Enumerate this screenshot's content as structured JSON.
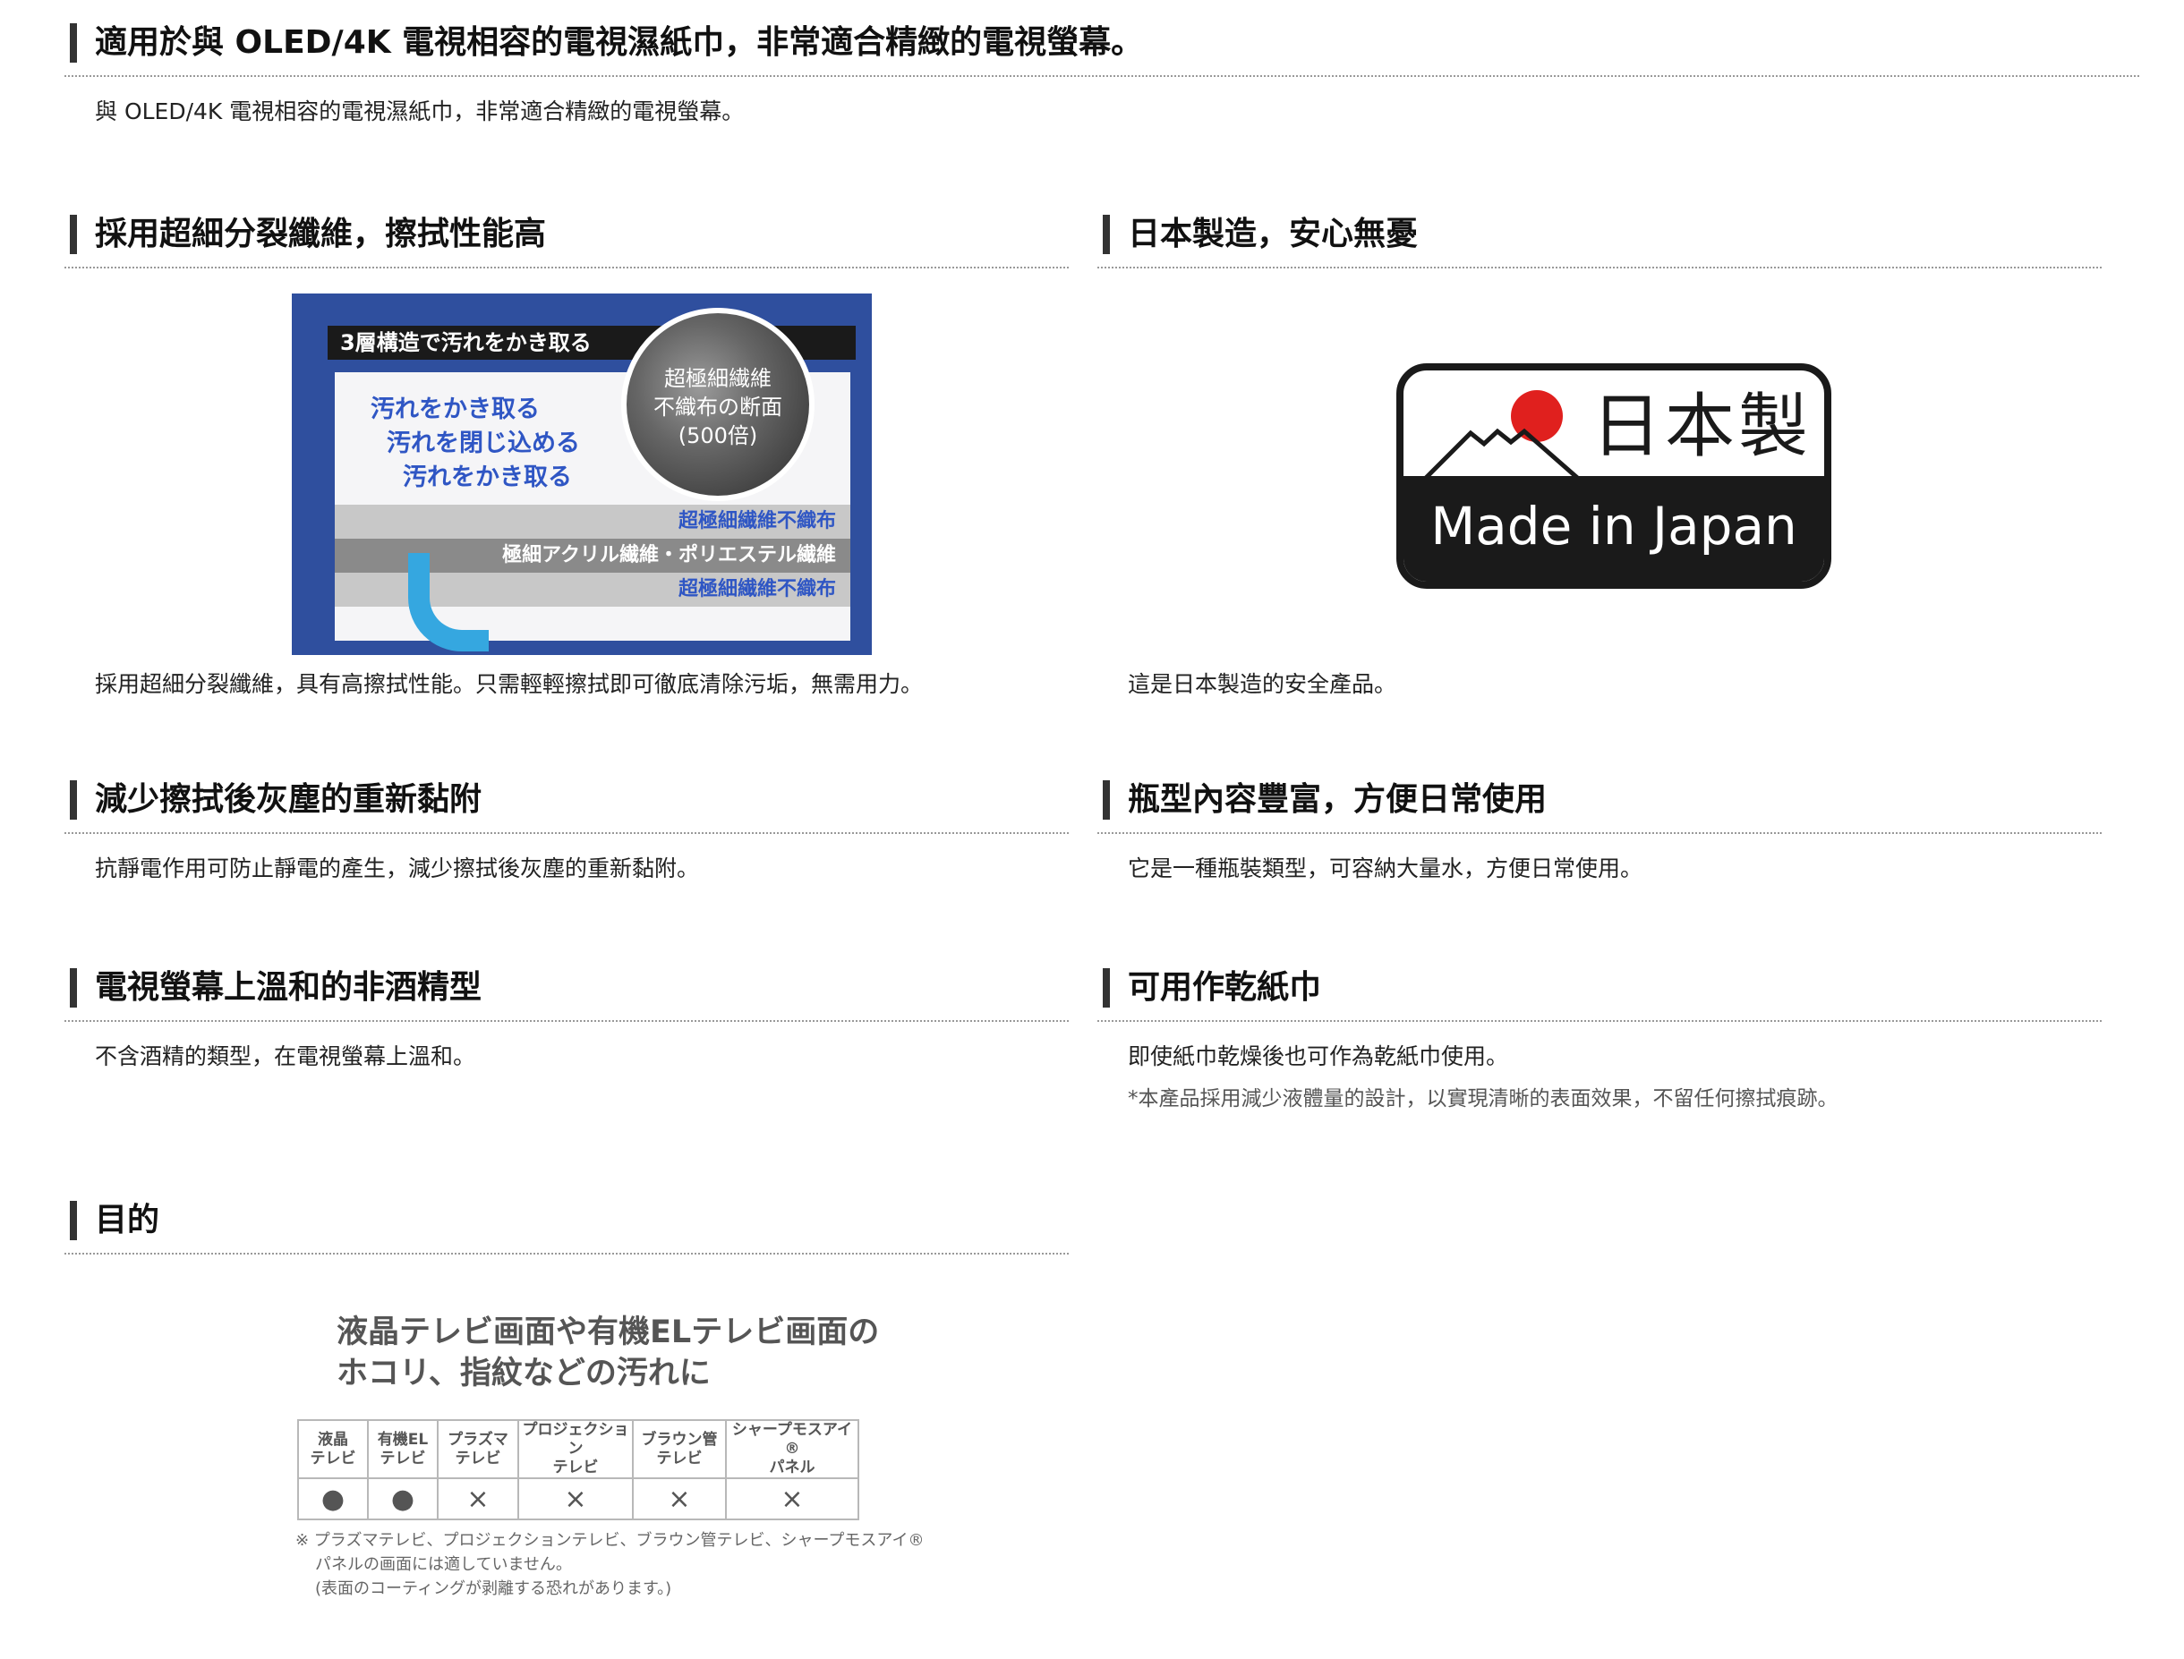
{
  "sections": {
    "top": {
      "heading": "適用於與 OLED/4K 電視相容的電視濕紙巾，非常適合精緻的電視螢幕。",
      "text": "與 OLED/4K 電視相容的電視濕紙巾，非常適合精緻的電視螢幕。"
    },
    "fiber": {
      "heading": "採用超細分裂纖維，擦拭性能高",
      "text": "採用超細分裂纖維，具有高擦拭性能。只需輕輕擦拭即可徹底清除污垢，無需用力。"
    },
    "japan": {
      "heading": "日本製造，安心無憂",
      "text": "這是日本製造的安全產品。"
    },
    "dust": {
      "heading": "減少擦拭後灰塵的重新黏附",
      "text": "抗靜電作用可防止靜電的產生，減少擦拭後灰塵的重新黏附。"
    },
    "bottle": {
      "heading": "瓶型內容豐富，方便日常使用",
      "text": "它是一種瓶裝類型，可容納大量水，方便日常使用。"
    },
    "alcohol": {
      "heading": "電視螢幕上溫和的非酒精型",
      "text": "不含酒精的類型，在電視螢幕上溫和。"
    },
    "dry": {
      "heading": "可用作乾紙巾",
      "text": "即使紙巾乾燥後也可作為乾紙巾使用。",
      "note": "*本產品採用減少液體量的設計，以實現清晰的表面效果，不留任何擦拭痕跡。"
    },
    "purpose": {
      "heading": "目的"
    }
  },
  "fiber_graphic": {
    "title": "3層構造で汚れをかき取る",
    "lines": [
      "汚れをかき取る",
      "汚れを閉じ込める",
      "汚れをかき取る"
    ],
    "circle": [
      "超極細繊維",
      "不織布の断面",
      "(500倍)"
    ],
    "layers": [
      "超極細繊維不織布",
      "極細アクリル繊維・ポリエステル繊維",
      "超極細繊維不織布"
    ],
    "colors": {
      "background": "#2f4f9e",
      "accent_text": "#2f56c4",
      "arrow": "#35a7e0"
    }
  },
  "made_in_japan": {
    "jp": "日本製",
    "en": "Made in Japan",
    "colors": {
      "sun": "#e0201e",
      "ink": "#1a1a1a"
    }
  },
  "purpose_graphic": {
    "title_lines": [
      "液晶テレビ画面や有機ELテレビ画面の",
      "ホコリ、指紋などの汚れに"
    ],
    "columns": [
      {
        "line1": "液晶",
        "line2": "テレビ",
        "mark": "●"
      },
      {
        "line1": "有機EL",
        "line2": "テレビ",
        "mark": "●"
      },
      {
        "line1": "プラズマ",
        "line2": "テレビ",
        "mark": "×"
      },
      {
        "line1": "プロジェクション",
        "line2": "テレビ",
        "mark": "×"
      },
      {
        "line1": "ブラウン管",
        "line2": "テレビ",
        "mark": "×"
      },
      {
        "line1": "シャープモスアイ®",
        "line2": "パネル",
        "mark": "×"
      }
    ],
    "note_lines": [
      "※ プラズマテレビ、プロジェクションテレビ、ブラウン管テレビ、シャープモスアイ®",
      "パネルの画面には適していません。",
      "(表面のコーティングが剥離する恐れがあります。)"
    ]
  }
}
